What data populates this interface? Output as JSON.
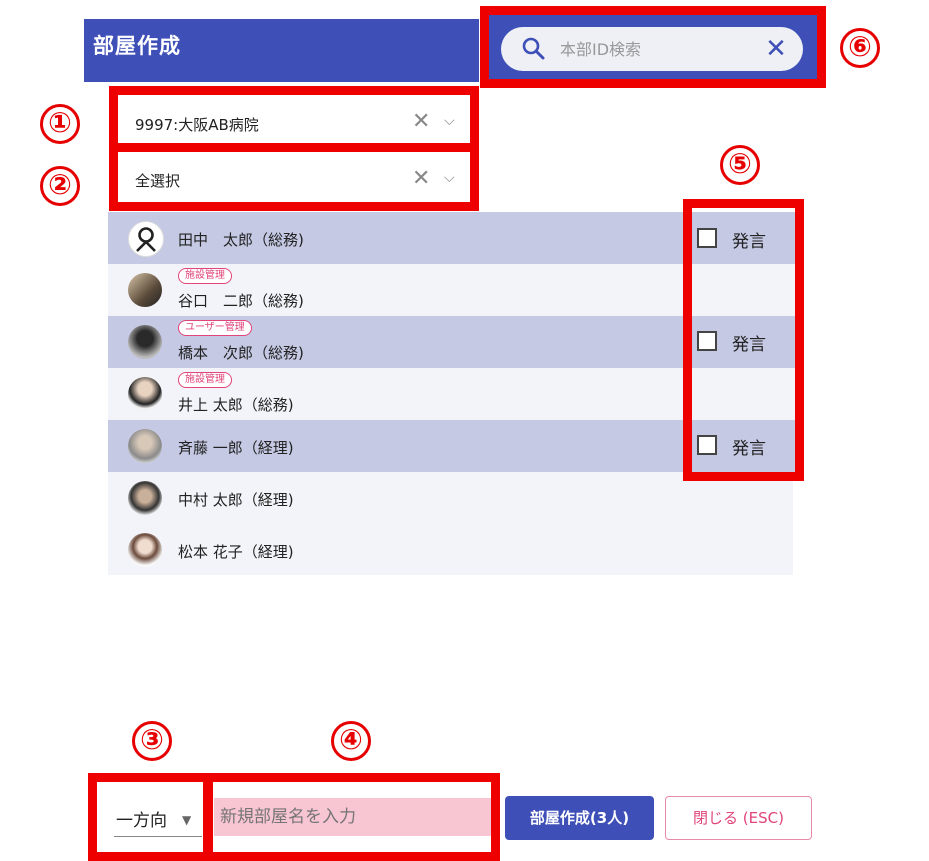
{
  "header": {
    "title": "部屋作成"
  },
  "search": {
    "placeholder": "本部ID検索",
    "clear_symbol": "✕"
  },
  "callouts": [
    "①",
    "②",
    "③",
    "④",
    "⑤",
    "⑥"
  ],
  "hospital_select": {
    "value": "9997:大阪AB病院",
    "clear_symbol": "✕",
    "chevron_symbol": "⌵"
  },
  "group_select": {
    "value": "全選択",
    "clear_symbol": "✕",
    "chevron_symbol": "⌵"
  },
  "users": [
    {
      "name": "田中　太郎（総務)",
      "badge": "",
      "avatar": "person-outline-icon",
      "speak": "発言"
    },
    {
      "name": "谷口　二郎（総務)",
      "badge": "施設管理",
      "avatar": "avatar-photo",
      "speak": ""
    },
    {
      "name": "橋本　次郎（総務)",
      "badge": "ユーザー管理",
      "avatar": "avatar-photo",
      "speak": "発言"
    },
    {
      "name": "井上 太郎（総務)",
      "badge": "施設管理",
      "avatar": "avatar-photo",
      "speak": ""
    },
    {
      "name": "斉藤 一郎（経理)",
      "badge": "",
      "avatar": "avatar-photo",
      "speak": "発言"
    },
    {
      "name": "中村 太郎（経理)",
      "badge": "",
      "avatar": "avatar-photo",
      "speak": ""
    },
    {
      "name": "松本 花子（経理)",
      "badge": "",
      "avatar": "avatar-photo",
      "speak": ""
    }
  ],
  "bottom": {
    "direction": "一方向",
    "room_name_placeholder": "新規部屋名を入力",
    "create_button": "部屋作成(3人)",
    "close_button": "閉じる (ESC)"
  },
  "colors": {
    "primary": "#3f4fb8",
    "highlight_red": "#ee0000",
    "accent_pink": "#e0457b",
    "row_selected": "#c5c9e4"
  }
}
